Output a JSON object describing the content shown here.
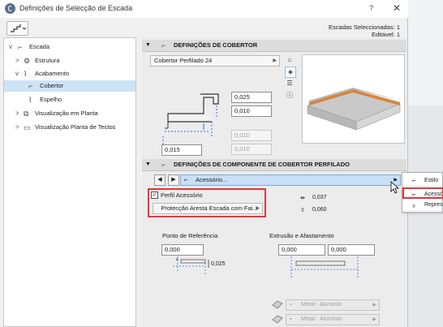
{
  "window": {
    "title": "Definições de Selecção de Escada",
    "help": "?",
    "close": "✕"
  },
  "selection_info": {
    "selected": "Escadas Seleccionadas: 1",
    "editable": "Editável: 1"
  },
  "tree": [
    {
      "label": "Escada",
      "icon": "stair-icon",
      "chevron": "v"
    },
    {
      "label": "Estrutura",
      "icon": "structure-icon",
      "chevron": ">"
    },
    {
      "label": "Acabamento",
      "icon": "finish-icon",
      "chevron": "v"
    },
    {
      "label": "Cobertor",
      "icon": "tread-icon",
      "chevron": "",
      "selected": true
    },
    {
      "label": "Espelho",
      "icon": "riser-icon",
      "chevron": ""
    },
    {
      "label": "Visualização em Planta",
      "icon": "floorplan-icon",
      "chevron": ">"
    },
    {
      "label": "Visualização Planta de Tectos",
      "icon": "ceiling-plan-icon",
      "chevron": ">"
    }
  ],
  "tread_settings": {
    "header": "DEFINIÇÕES DE COBERTOR",
    "profile": "Cobertor Perfilado 24",
    "thickness_top": "0,025",
    "thickness_front": "0,010",
    "offset_disabled_1": "0,010",
    "offset_disabled_2": "0,010",
    "nosing": "0,015"
  },
  "component_settings": {
    "header": "DEFINIÇÕES DE COMPONENTE DE COBERTOR PERFILADO",
    "component": "Acessório...",
    "profile_checkbox": "Perfil Acessório",
    "profile_value": "Protecção Aresta Escada com Fai...",
    "dim_width": "0,037",
    "dim_height": "0,060",
    "reference_label": "Ponto de Referência",
    "reference_value": "0,000",
    "reference_offset": "0,025",
    "extrusion_label": "Extrusão e Afastamento",
    "extrusion_a": "0,000",
    "extrusion_b": "0,000",
    "material_1": "Metal - Alumínio",
    "material_2": "Metal - Alumínio"
  },
  "popup": {
    "items": [
      {
        "label": "Estilo",
        "icon": "style-icon"
      },
      {
        "label": "Acessório",
        "icon": "accessory-icon"
      },
      {
        "label": "Representação",
        "icon": "representation-icon"
      }
    ]
  },
  "colors": {
    "selection": "#cde4f7",
    "highlight": "#e0383b",
    "accent_bar": "#c8dff5",
    "tread_edge": "#d8843c"
  }
}
